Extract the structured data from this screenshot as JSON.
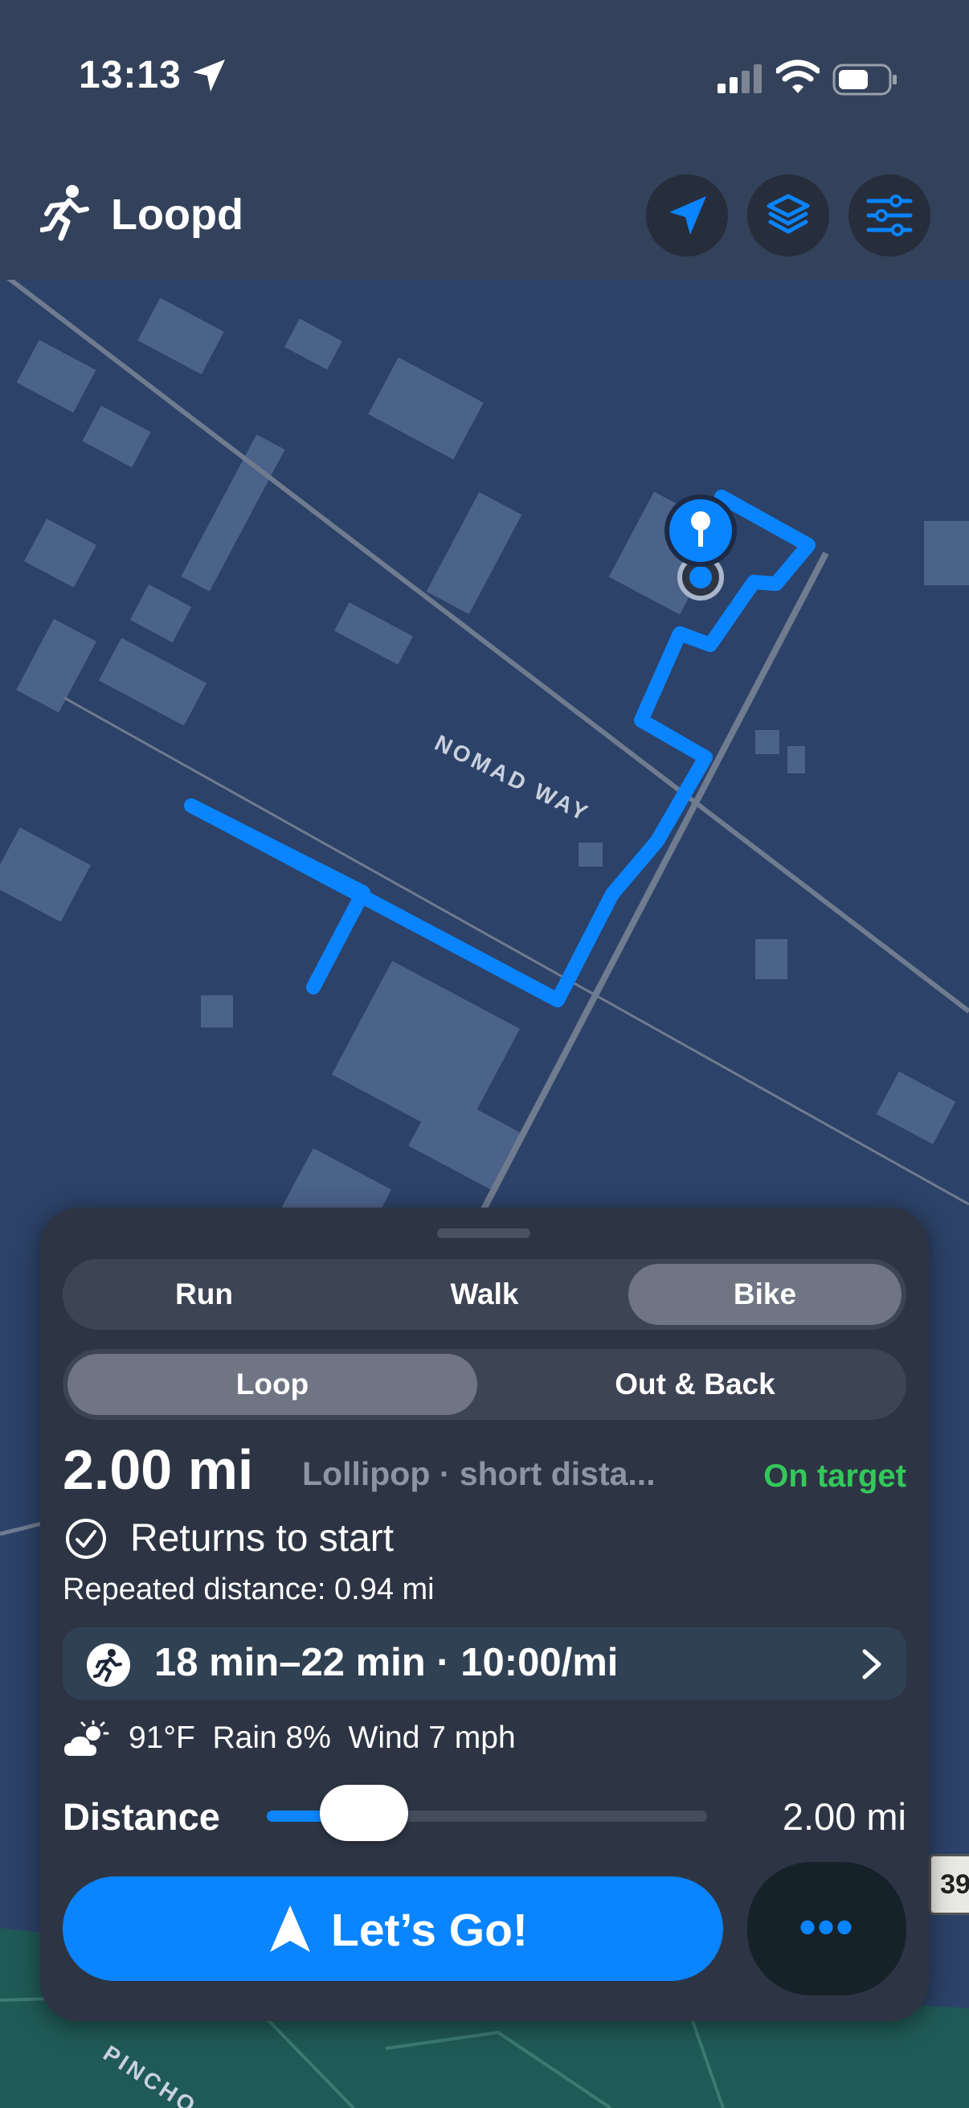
{
  "status_bar": {
    "time": "13:13"
  },
  "header": {
    "title": "Loopd"
  },
  "map": {
    "road_label": "NOMAD WAY",
    "road_label_2": "PINCHO",
    "highway_badge": "39"
  },
  "activity_tabs": [
    {
      "label": "Run",
      "selected": false
    },
    {
      "label": "Walk",
      "selected": false
    },
    {
      "label": "Bike",
      "selected": true
    }
  ],
  "route_type_tabs": [
    {
      "label": "Loop",
      "selected": true
    },
    {
      "label": "Out & Back",
      "selected": false
    }
  ],
  "route": {
    "distance": "2.00 mi",
    "description": "Lollipop · short dista...",
    "status": "On target",
    "returns_label": "Returns to start",
    "repeated": "Repeated distance: 0.94 mi"
  },
  "pace": {
    "text": "18 min–22 min · 10:00/mi"
  },
  "weather": {
    "text": "91°F  Rain 8%  Wind 7 mph"
  },
  "distance_slider": {
    "label": "Distance",
    "value": "2.00 mi",
    "level": 0.22
  },
  "actions": {
    "go_label": "Let’s Go!",
    "more_label": "•••"
  },
  "colors": {
    "accent": "#0a84ff",
    "on_target": "#34c85a",
    "sheet": "#2d3544",
    "map": "#2c4268"
  },
  "icons": [
    "location-arrow-icon",
    "signal-icon",
    "wifi-icon",
    "battery-icon",
    "runner-icon",
    "layers-icon",
    "sliders-icon",
    "checkmark-circle-icon",
    "weather-icon",
    "chevron-right-icon",
    "navigation-arrow-icon"
  ]
}
